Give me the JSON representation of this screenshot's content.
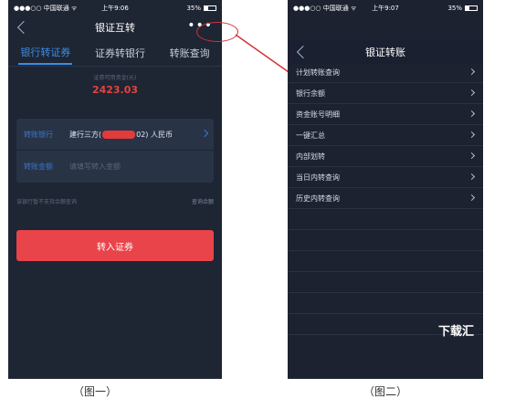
{
  "phone1": {
    "status": {
      "carrier": "●●●○○ 中国联通 ᯤ",
      "time": "上午9:06",
      "battery": "35%"
    },
    "nav_title": "银证互转",
    "more_label": "•••",
    "tabs": [
      "银行转证券",
      "证券转银行",
      "转账查询"
    ],
    "balance_label": "证券可用资金(元)",
    "balance_value": "2423.03",
    "form": {
      "bank_label": "转账银行",
      "bank_value_prefix": "建行三方(",
      "bank_value_suffix": "02) 人民币",
      "amount_label": "转账金额",
      "amount_placeholder": "请填写转入金额"
    },
    "note": "该银行暂不支持余额查询",
    "query_balance": "查询余额",
    "submit": "转入证券"
  },
  "phone2": {
    "status": {
      "carrier": "●●●○○ 中国联通 ᯤ",
      "time": "上午9:07",
      "battery": "35%"
    },
    "nav_title": "银证转账",
    "menu": [
      "计划转账查询",
      "银行余额",
      "资金账号明细",
      "一键汇总",
      "内部划转",
      "当日内转查询",
      "历史内转查询"
    ],
    "watermark": "下载汇"
  },
  "captions": [
    "（图一）",
    "（图二）"
  ],
  "colors": {
    "accent_blue": "#3a8ee8",
    "danger_red": "#e8444a",
    "bg_dark": "#1e2533"
  }
}
